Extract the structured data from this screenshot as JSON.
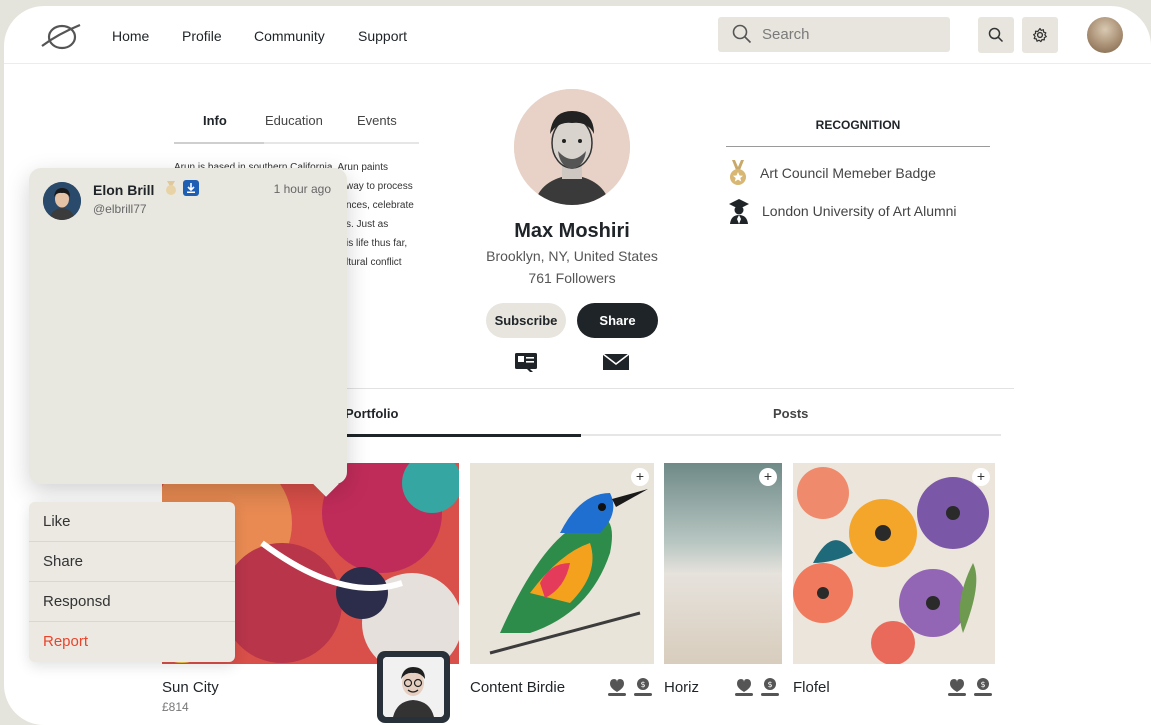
{
  "nav": {
    "links": [
      "Home",
      "Profile",
      "Community",
      "Support"
    ],
    "search_placeholder": "Search"
  },
  "info_tabs": [
    "Info",
    "Education",
    "Events"
  ],
  "bio_lines": [
    "Arun is based in southern California. Arun paints",
    "way to process",
    "nces, celebrate",
    "s. Just as",
    "is life thus far,",
    "ltural conflict"
  ],
  "profile": {
    "name": "Max Moshiri",
    "location": "Brooklyn, NY, United States",
    "followers": "761 Followers",
    "subscribe_label": "Subscribe",
    "share_label": "Share"
  },
  "recognition": {
    "title": "RECOGNITION",
    "items": [
      "Art Council Memeber Badge",
      "London University of Art Alumni"
    ]
  },
  "portfolio_tabs": [
    "Portfolio",
    "Posts"
  ],
  "artworks": [
    {
      "title": "Sun City",
      "price": "£814"
    },
    {
      "title": "Content Birdie"
    },
    {
      "title": "Horiz"
    },
    {
      "title": "Flofel"
    }
  ],
  "popover": {
    "name": "Elon Brill",
    "handle": "@elbrill77",
    "time": "1 hour ago"
  },
  "context_menu": [
    "Like",
    "Share",
    "Responsd",
    "Report"
  ],
  "colors": {
    "accent_dark": "#1f2428",
    "panel": "#e9e8e0",
    "danger": "#e8452c"
  }
}
